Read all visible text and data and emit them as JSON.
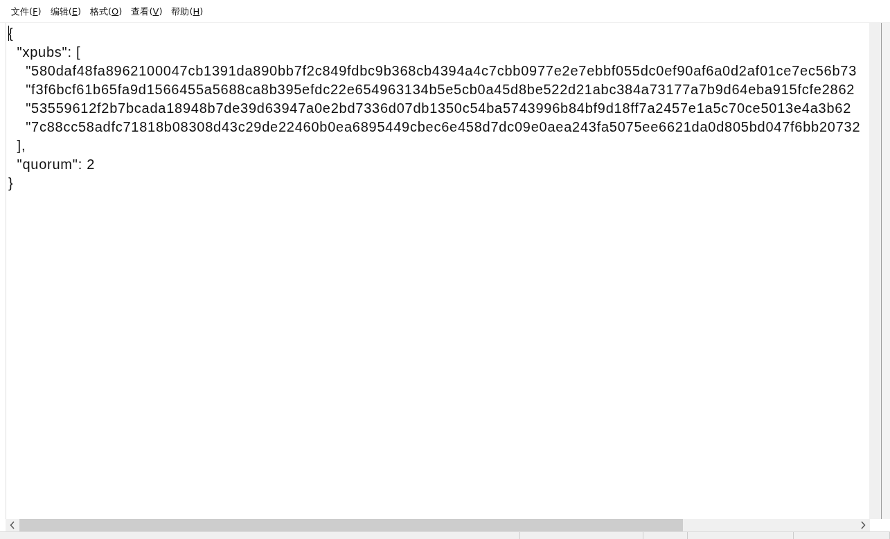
{
  "menu": [
    {
      "label": "文件(F)"
    },
    {
      "label": "编辑(E)"
    },
    {
      "label": "格式(O)"
    },
    {
      "label": "查看(V)"
    },
    {
      "label": "帮助(H)"
    }
  ],
  "editor": {
    "lines": [
      "{",
      "  \"xpubs\": [",
      "    \"580daf48fa8962100047cb1391da890bb7f2c849fdbc9b368cb4394a4c7cbb0977e2e7ebbf055dc0ef90af6a0d2af01ce7ec56b73",
      "    \"f3f6bcf61b65fa9d1566455a5688ca8b395efdc22e654963134b5e5cb0a45d8be522d21abc384a73177a7b9d64eba915fcfe2862",
      "    \"53559612f2b7bcada18948b7de39d63947a0e2bd7336d07db1350c54ba5743996b84bf9d18ff7a2457e1a5c70ce5013e4a3b62",
      "    \"7c88cc58adfc71818b08308d43c29de22460b0ea6895449cbec6e458d7dc09e0aea243fa5075ee6621da0d805bd047f6bb20732",
      "  ],",
      "  \"quorum\": 2",
      "}"
    ]
  }
}
